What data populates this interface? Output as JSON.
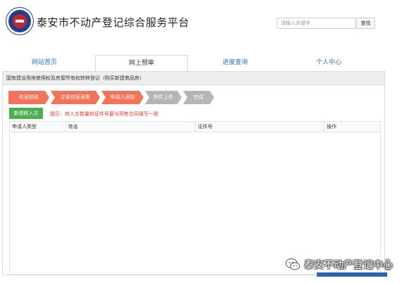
{
  "header": {
    "title": "泰安市不动产登记综合服务平台",
    "search_placeholder": "请输入关键字",
    "search_button": "查找"
  },
  "nav": {
    "tabs": [
      {
        "label": "网站首页",
        "active": false
      },
      {
        "label": "网上预审",
        "active": true
      },
      {
        "label": "进度查询",
        "active": false
      },
      {
        "label": "个人中心",
        "active": false
      }
    ]
  },
  "panel": {
    "title": "国有建设用地使用权及房屋所有权转移登记（购买新建商品房）",
    "steps": [
      {
        "label": "信息校验",
        "state": "done"
      },
      {
        "label": "交易信息采集",
        "state": "done"
      },
      {
        "label": "申请人添加",
        "state": "current"
      },
      {
        "label": "附件上传",
        "state": "pending"
      },
      {
        "label": "完成",
        "state": "pending"
      }
    ],
    "add_button": "新增转入方",
    "tip": "提示：转入方数量和证件号要与预售合同填写一致",
    "table": {
      "columns": [
        "申请人类型",
        "姓名",
        "证件号",
        "操作"
      ]
    }
  },
  "watermark": {
    "text": "泰安不动产登记中心"
  },
  "colors": {
    "step_done": "#f2725a",
    "step_pending": "#b5b5b5",
    "add_button": "#4cb050",
    "tip": "#e53935",
    "nav_link": "#2a73c8"
  }
}
